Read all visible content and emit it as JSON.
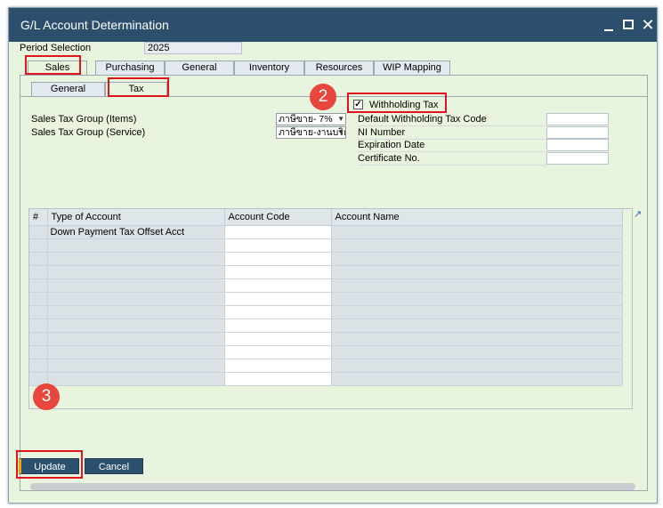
{
  "window": {
    "title": "G/L Account Determination"
  },
  "period": {
    "label": "Period Selection",
    "value": "2025"
  },
  "tabs": [
    {
      "label": "Sales",
      "active": true
    },
    {
      "label": "Purchasing",
      "active": false
    },
    {
      "label": "General",
      "active": false
    },
    {
      "label": "Inventory",
      "active": false
    },
    {
      "label": "Resources",
      "active": false
    },
    {
      "label": "WIP Mapping",
      "active": false
    }
  ],
  "subtabs": [
    {
      "label": "General",
      "active": false
    },
    {
      "label": "Tax",
      "active": true
    }
  ],
  "sales_tax": {
    "items_label": "Sales Tax Group (Items)",
    "items_value": "ภาษีขาย- 7%",
    "service_label": "Sales Tax Group (Service)",
    "service_value": "ภาษีขาย-งานบริก"
  },
  "withholding": {
    "checkbox_label": "Withholding Tax",
    "checked": true,
    "check_mark": "✓",
    "fields": [
      {
        "label": "Default Withholding Tax Code",
        "value": ""
      },
      {
        "label": "NI Number",
        "value": ""
      },
      {
        "label": "Expiration Date",
        "value": ""
      },
      {
        "label": "Certificate No.",
        "value": ""
      }
    ]
  },
  "grid": {
    "columns": [
      "#",
      "Type of Account",
      "Account Code",
      "Account Name"
    ],
    "rows": [
      [
        "",
        "Down Payment Tax Offset Acct",
        "",
        ""
      ],
      [
        "",
        "",
        "",
        ""
      ],
      [
        "",
        "",
        "",
        ""
      ],
      [
        "",
        "",
        "",
        ""
      ],
      [
        "",
        "",
        "",
        ""
      ],
      [
        "",
        "",
        "",
        ""
      ],
      [
        "",
        "",
        "",
        ""
      ],
      [
        "",
        "",
        "",
        ""
      ],
      [
        "",
        "",
        "",
        ""
      ],
      [
        "",
        "",
        "",
        ""
      ],
      [
        "",
        "",
        "",
        ""
      ],
      [
        "",
        "",
        "",
        ""
      ]
    ],
    "expand_icon": "↗"
  },
  "buttons": {
    "update": "Update",
    "cancel": "Cancel"
  },
  "annotations": {
    "step2": "2",
    "step3": "3"
  },
  "colors": {
    "titlebar": "#2c4f6e",
    "panel": "#e9f4de",
    "annotation_red": "#e0141e",
    "update_accent": "#f0a30a"
  }
}
